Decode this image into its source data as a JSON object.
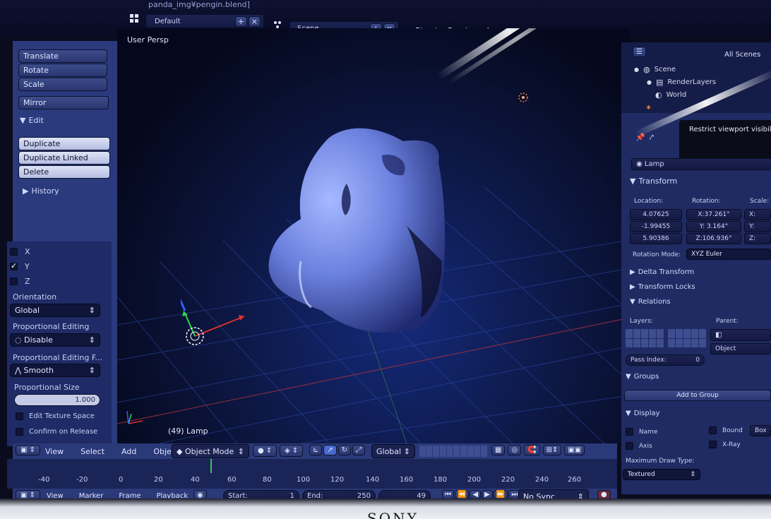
{
  "window": {
    "title": "panda_img¥pengin.blend]",
    "layout": "Default",
    "scene": "Scene",
    "engine": "Blender Render"
  },
  "toolshelf": {
    "transform_buttons": [
      "Translate",
      "Rotate",
      "Scale"
    ],
    "mirror_label": "Mirror",
    "edit_header": "Edit",
    "edit_buttons": [
      "Duplicate",
      "Duplicate Linked",
      "Delete"
    ],
    "history_label": "History"
  },
  "operator": {
    "axes": [
      {
        "label": "X",
        "checked": false
      },
      {
        "label": "Y",
        "checked": true
      },
      {
        "label": "Z",
        "checked": false
      }
    ],
    "orientation_label": "Orientation",
    "orientation_value": "Global",
    "prop_edit_label": "Proportional Editing",
    "prop_edit_value": "Disable",
    "prop_falloff_label": "Proportional Editing F...",
    "prop_falloff_value": "Smooth",
    "prop_size_label": "Proportional Size",
    "prop_size_value": "1.000",
    "edit_texture_label": "Edit Texture Space",
    "confirm_label": "Confirm on Release"
  },
  "viewport": {
    "view_label": "User Persp",
    "object_label": "(49) Lamp"
  },
  "vp_header": {
    "menus": [
      "View",
      "Select",
      "Add",
      "Object"
    ],
    "mode": "Object Mode",
    "orientation": "Global"
  },
  "timeline": {
    "ticks": [
      "-40",
      "-20",
      "0",
      "20",
      "40",
      "60",
      "80",
      "100",
      "120",
      "140",
      "160",
      "180",
      "200",
      "220",
      "240",
      "260"
    ],
    "menus": [
      "View",
      "Marker",
      "Frame",
      "Playback"
    ],
    "start_label": "Start:",
    "start_value": "1",
    "end_label": "End:",
    "end_value": "250",
    "current_frame": "49",
    "sync": "No Sync"
  },
  "outliner": {
    "filter": "All Scenes",
    "items": [
      "Scene",
      "RenderLayers",
      "World"
    ]
  },
  "properties": {
    "tooltip": "Restrict viewport visibility",
    "object_name": "Lamp",
    "transform_header": "Transform",
    "location_label": "Location:",
    "rotation_label": "Rotation:",
    "scale_label": "Scale:",
    "location": [
      "4.07625",
      "-1.99455",
      "5.90386"
    ],
    "rotation": [
      "X:37.261°",
      "Y: 3.164°",
      "Z:106.936°"
    ],
    "scale": [
      "X:",
      "Y:",
      "Z:"
    ],
    "rotation_mode_label": "Rotation Mode:",
    "rotation_mode_value": "XYZ Euler",
    "delta_header": "Delta Transform",
    "locks_header": "Transform Locks",
    "relations_header": "Relations",
    "layers_label": "Layers:",
    "parent_label": "Parent:",
    "parent_type": "Object",
    "pass_index_label": "Pass Index:",
    "pass_index_value": "0",
    "groups_header": "Groups",
    "add_group_label": "Add to Group",
    "display_header": "Display",
    "display_name": "Name",
    "display_axis": "Axis",
    "display_bound": "Bound",
    "display_box": "Box",
    "display_xray": "X-Ray",
    "max_draw_label": "Maximum Draw Type:",
    "max_draw_value": "Textured"
  },
  "bezel": {
    "brand": "SONY"
  },
  "colors": {
    "viewport_bg": "#0c1640",
    "panel": "#2a3a7c",
    "mesh": "#7a92e8",
    "axis_x": "#e03030",
    "axis_y": "#30d050",
    "axis_z": "#3060ff"
  }
}
